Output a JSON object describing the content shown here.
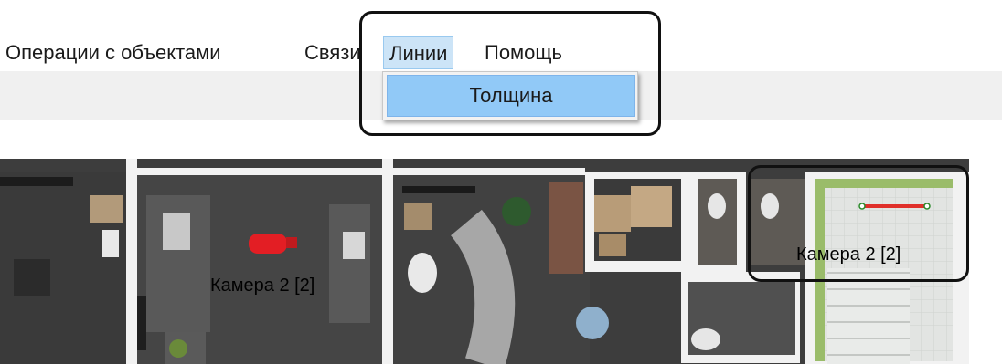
{
  "menu": {
    "items": [
      {
        "label": "Операции с объектами"
      },
      {
        "label": "Связи"
      },
      {
        "label": "Линии"
      },
      {
        "label": "Помощь"
      }
    ],
    "active_index": 2,
    "dropdown": {
      "items": [
        {
          "label": "Толщина"
        }
      ]
    }
  },
  "map": {
    "camera_labels": [
      "Камера 2 [2]",
      "Камера 2 [2]"
    ]
  },
  "colors": {
    "menu_highlight": "#cce4f7",
    "dropdown_selected": "#91c9f7",
    "camera_line": "#e0302a",
    "camera_icon": "#e31e24"
  }
}
